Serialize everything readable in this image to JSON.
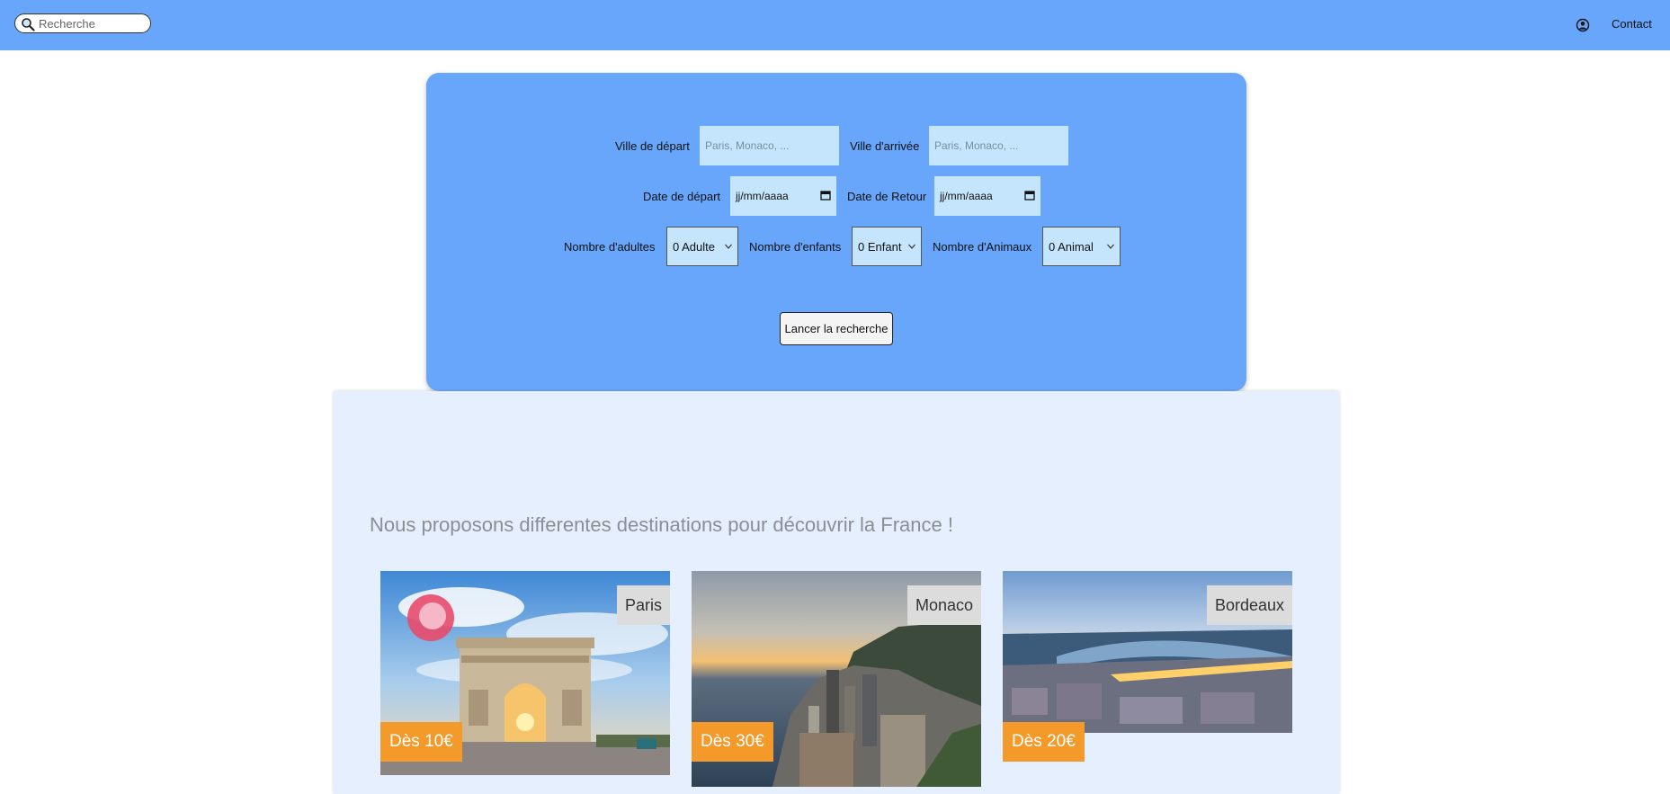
{
  "header": {
    "search_placeholder": "Recherche",
    "contact_label": "Contact"
  },
  "form": {
    "departure_city_label": "Ville de départ",
    "departure_city_placeholder": "Paris, Monaco, ...",
    "arrival_city_label": "Ville d'arrivée",
    "arrival_city_placeholder": "Paris, Monaco, ...",
    "departure_date_label": "Date de départ",
    "departure_date_value": "jj/mm/aaaa",
    "return_date_label": "Date de Retour",
    "return_date_value": "jj/mm/aaaa",
    "adults_label": "Nombre d'adultes",
    "adults_value": "0 Adulte",
    "children_label": "Nombre d'enfants",
    "children_value": "0 Enfant",
    "animals_label": "Nombre d'Animaux",
    "animals_value": "0 Animal",
    "search_button": "Lancer la recherche"
  },
  "destinations": {
    "title": "Nous proposons differentes destinations pour découvrir la France !",
    "cards": [
      {
        "name": "Paris",
        "price": "Dès 10€"
      },
      {
        "name": "Monaco",
        "price": "Dès 30€"
      },
      {
        "name": "Bordeaux",
        "price": "Dès 20€"
      }
    ]
  },
  "colors": {
    "header_bg": "#68a6fb",
    "panel_bg": "#68a6fb",
    "input_bg": "#c5e5fc",
    "section_bg": "#e6effd",
    "price_badge": "#f39a2a",
    "name_badge": "#dcdcdc"
  }
}
